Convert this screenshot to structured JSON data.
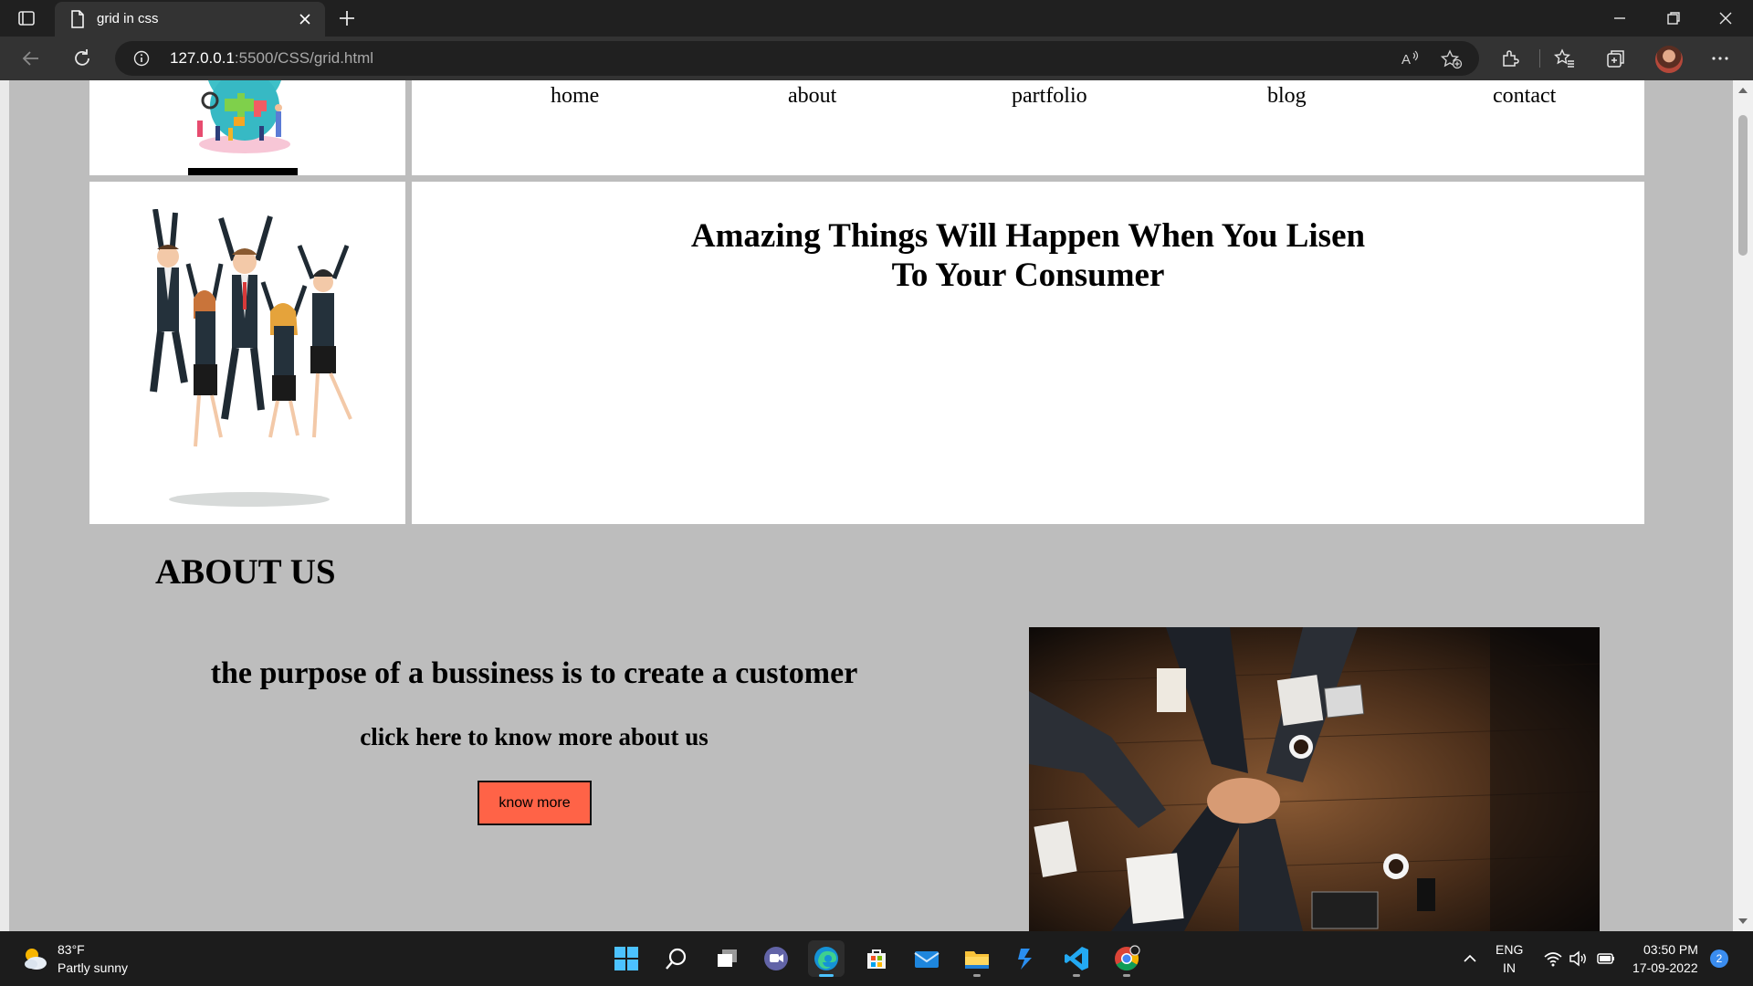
{
  "browser": {
    "tab": {
      "title": "grid in css",
      "icon": "page-icon",
      "close_icon": "close-icon"
    },
    "new_tab_icon": "plus-icon",
    "window_controls": [
      "minimize-icon",
      "restore-icon",
      "close-icon"
    ],
    "url": {
      "host": "127.0.0.1",
      "rest": ":5500/CSS/grid.html"
    },
    "toolbar_icons": [
      "read-aloud-icon",
      "add-favorite-icon",
      "extensions-icon",
      "favorites-icon",
      "collections-icon",
      "profile-avatar",
      "more-icon"
    ]
  },
  "page": {
    "nav": {
      "links": [
        {
          "label": "home"
        },
        {
          "label": "about"
        },
        {
          "label": "partfolio"
        },
        {
          "label": "blog"
        },
        {
          "label": "contact"
        }
      ]
    },
    "hero": {
      "title_line1": "Amazing Things Will Happen When You Lisen",
      "title_line2": "To Your Consumer"
    },
    "about": {
      "heading": "ABOUT US",
      "purpose": "the purpose of a bussiness is to create a customer",
      "cta_text": "click here to know more about us",
      "button_label": "know more",
      "button_color": "#ff6347"
    },
    "background_color": "#bdbdbd"
  },
  "taskbar": {
    "weather": {
      "temp": "83°F",
      "desc": "Partly sunny"
    },
    "apps": [
      "windows-start-icon",
      "search-icon",
      "task-view-icon",
      "teams-chat-icon",
      "edge-icon",
      "store-icon",
      "mail-icon",
      "file-explorer-icon",
      "power-automate-icon",
      "vscode-icon",
      "chrome-icon"
    ],
    "language": {
      "line1": "ENG",
      "line2": "IN"
    },
    "clock": {
      "time": "03:50 PM",
      "date": "17-09-2022"
    },
    "notifications": "2"
  }
}
